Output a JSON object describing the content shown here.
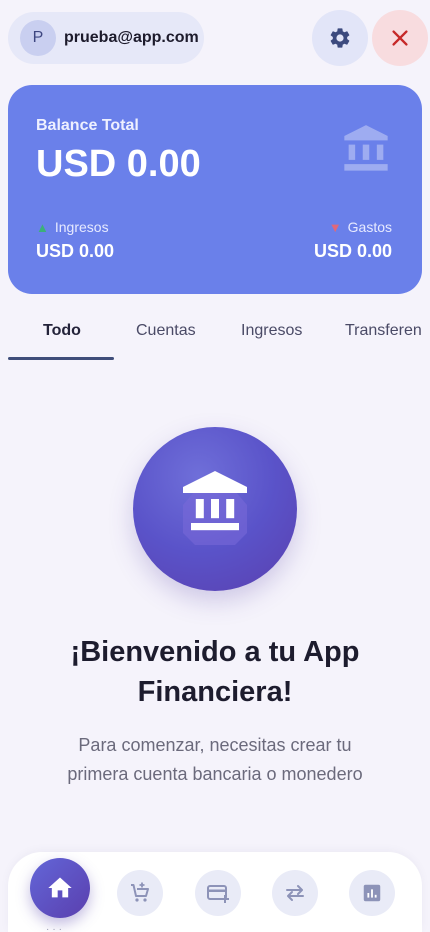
{
  "header": {
    "avatar_initial": "P",
    "user_email": "prueba@app.com",
    "settings_icon": "gear-icon",
    "close_icon": "close-icon"
  },
  "balance": {
    "label": "Balance Total",
    "amount": "USD 0.00",
    "income_label": "Ingresos",
    "income_amount": "USD 0.00",
    "expense_label": "Gastos",
    "expense_amount": "USD 0.00"
  },
  "tabs": [
    {
      "label": "Todo",
      "active": true
    },
    {
      "label": "Cuentas",
      "active": false
    },
    {
      "label": "Ingresos",
      "active": false
    },
    {
      "label": "Transferen",
      "active": false
    }
  ],
  "welcome": {
    "title": "¡Bienvenido a tu App Financiera!",
    "subtitle": "Para comenzar, necesitas crear tu primera cuenta bancaria o monedero"
  },
  "bottom_nav": [
    {
      "icon": "home-icon"
    },
    {
      "icon": "add-cart-icon"
    },
    {
      "icon": "add-card-icon"
    },
    {
      "icon": "transfer-icon"
    },
    {
      "icon": "chart-icon"
    }
  ],
  "colors": {
    "card": "#6a80ea",
    "accent": "#5a53c9",
    "close": "#c62828",
    "income": "#3bb07a",
    "expense": "#e0687a"
  }
}
